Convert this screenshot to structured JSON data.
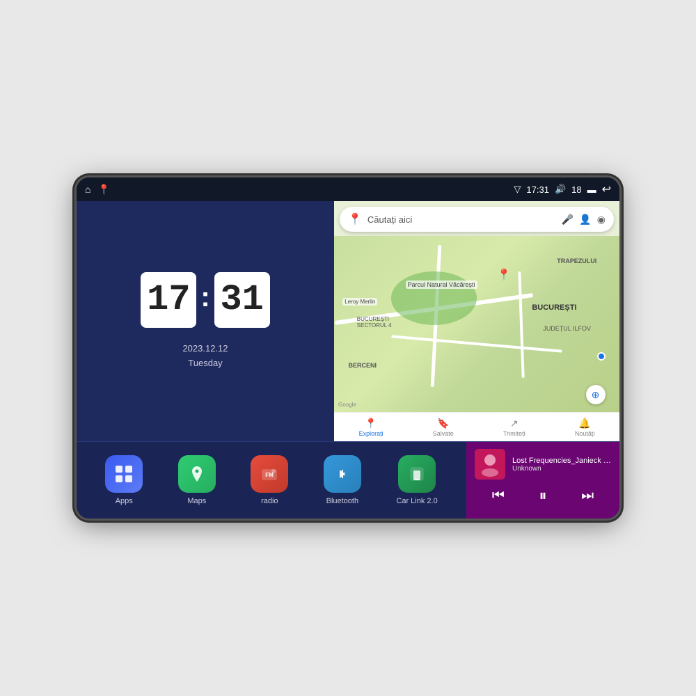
{
  "device": {
    "status_bar": {
      "signal_icon": "▽",
      "time": "17:31",
      "volume_icon": "🔊",
      "battery_level": "18",
      "battery_icon": "🔋",
      "back_icon": "↩"
    },
    "clock": {
      "hours": "17",
      "minutes": "31",
      "date": "2023.12.12",
      "day": "Tuesday"
    },
    "map": {
      "search_placeholder": "Căutați aici",
      "labels": {
        "trapezului": "TRAPEZULUI",
        "bucuresti": "BUCUREȘTI",
        "ilfov": "JUDEȚUL ILFOV",
        "berceni": "BERCENI",
        "vacaresti": "Parcul Natural Văcărești",
        "leroy": "Leroy Merlin",
        "sector4": "BUCUREȘTI\nSECTORUL 4"
      },
      "nav": [
        {
          "icon": "📍",
          "label": "Explorați",
          "active": true
        },
        {
          "icon": "🔖",
          "label": "Salvate",
          "active": false
        },
        {
          "icon": "➡",
          "label": "Trimiteți",
          "active": false
        },
        {
          "icon": "🔔",
          "label": "Noutăți",
          "active": false
        }
      ]
    },
    "apps": [
      {
        "id": "apps",
        "label": "Apps",
        "icon": "⊞"
      },
      {
        "id": "maps",
        "label": "Maps",
        "icon": "🗺"
      },
      {
        "id": "radio",
        "label": "radio",
        "icon": "📻"
      },
      {
        "id": "bluetooth",
        "label": "Bluetooth",
        "icon": "🔷"
      },
      {
        "id": "carlink",
        "label": "Car Link 2.0",
        "icon": "📱"
      }
    ],
    "music": {
      "title": "Lost Frequencies_Janieck Devy-...",
      "artist": "Unknown",
      "prev_label": "⏮",
      "play_label": "⏸",
      "next_label": "⏭"
    }
  }
}
